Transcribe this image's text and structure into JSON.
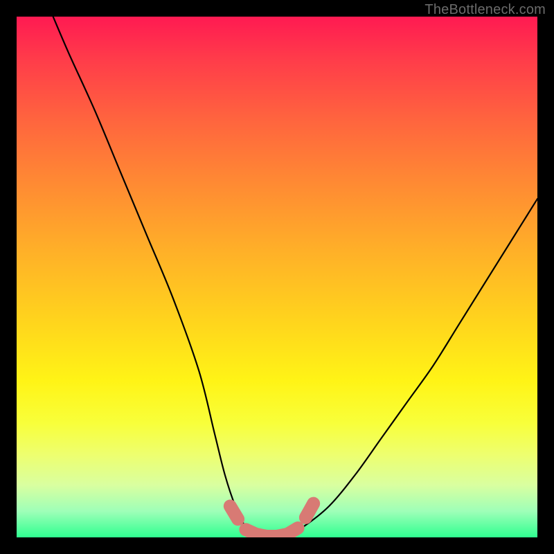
{
  "watermark": "TheBottleneck.com",
  "chart_data": {
    "type": "line",
    "title": "",
    "xlabel": "",
    "ylabel": "",
    "xlim": [
      0,
      100
    ],
    "ylim": [
      0,
      100
    ],
    "series": [
      {
        "name": "bottleneck-curve",
        "x": [
          7,
          10,
          15,
          20,
          25,
          30,
          35,
          38,
          40,
          42,
          44,
          46,
          48,
          50,
          52,
          55,
          60,
          65,
          70,
          75,
          80,
          85,
          90,
          95,
          100
        ],
        "y": [
          100,
          93,
          82,
          70,
          58,
          46,
          32,
          20,
          12,
          6,
          2,
          0.5,
          0,
          0,
          0.5,
          2,
          6,
          12,
          19,
          26,
          33,
          41,
          49,
          57,
          65
        ]
      }
    ],
    "highlight": {
      "name": "optimal-range",
      "points_xy": [
        [
          41,
          6
        ],
        [
          42.5,
          3.5
        ],
        [
          44,
          1.5
        ],
        [
          46,
          0.6
        ],
        [
          48,
          0.2
        ],
        [
          50,
          0.2
        ],
        [
          52,
          0.6
        ],
        [
          54,
          1.8
        ],
        [
          55.5,
          3.8
        ],
        [
          57,
          6.5
        ]
      ],
      "color": "#d87a74"
    }
  }
}
